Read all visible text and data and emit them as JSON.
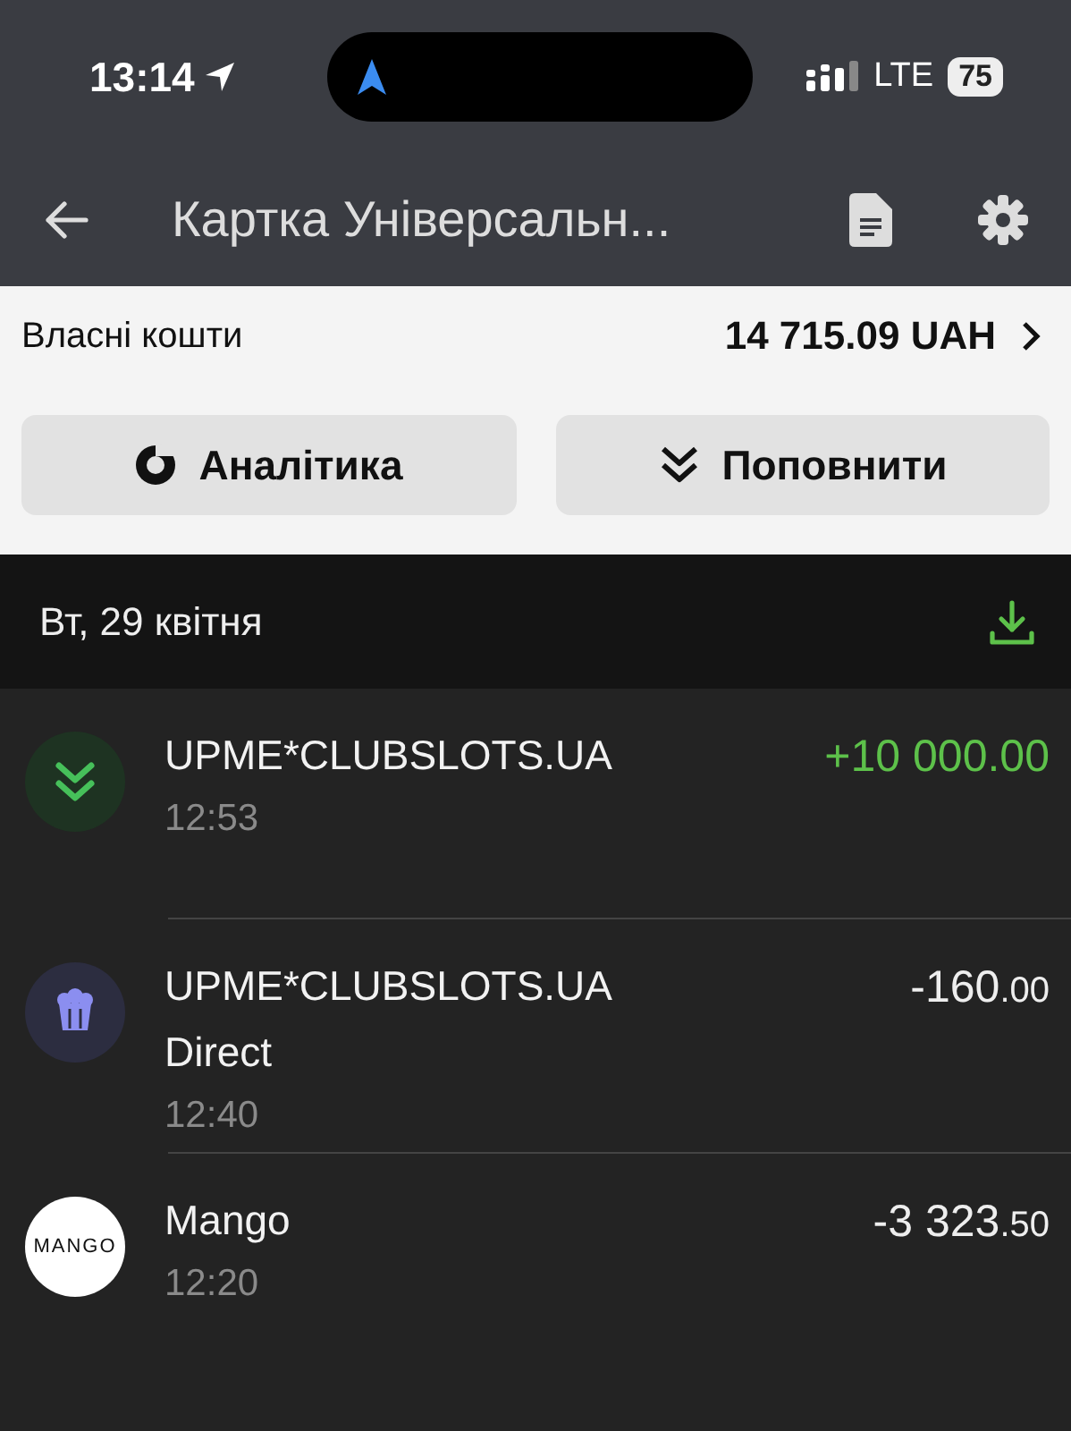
{
  "status_bar": {
    "time": "13:14",
    "network": "LTE",
    "battery": "75"
  },
  "header": {
    "title": "Картка Універсальн..."
  },
  "balance": {
    "label": "Власні кошти",
    "amount": "14 715.09 UAH"
  },
  "actions": [
    {
      "kind": "analytics",
      "label": "Аналітика"
    },
    {
      "kind": "topup",
      "label": "Поповнити"
    }
  ],
  "day": {
    "date": "Вт, 29 квітня"
  },
  "transactions": [
    {
      "kind": "deposit",
      "incoming": true,
      "name": "UPME*CLUBSLOTS.UA",
      "time": "12:53",
      "amount": "+10 000",
      "cents": ".00"
    },
    {
      "kind": "popcorn",
      "incoming": false,
      "name": "UPME*CLUBSLOTS.UA",
      "note": "Direct",
      "time": "12:40",
      "amount": "-160",
      "cents": ".00"
    },
    {
      "kind": "logo",
      "logo_text": "MANGO",
      "incoming": false,
      "name": "Mango",
      "time": "12:20",
      "amount": "-3 323",
      "cents": ".50"
    }
  ]
}
